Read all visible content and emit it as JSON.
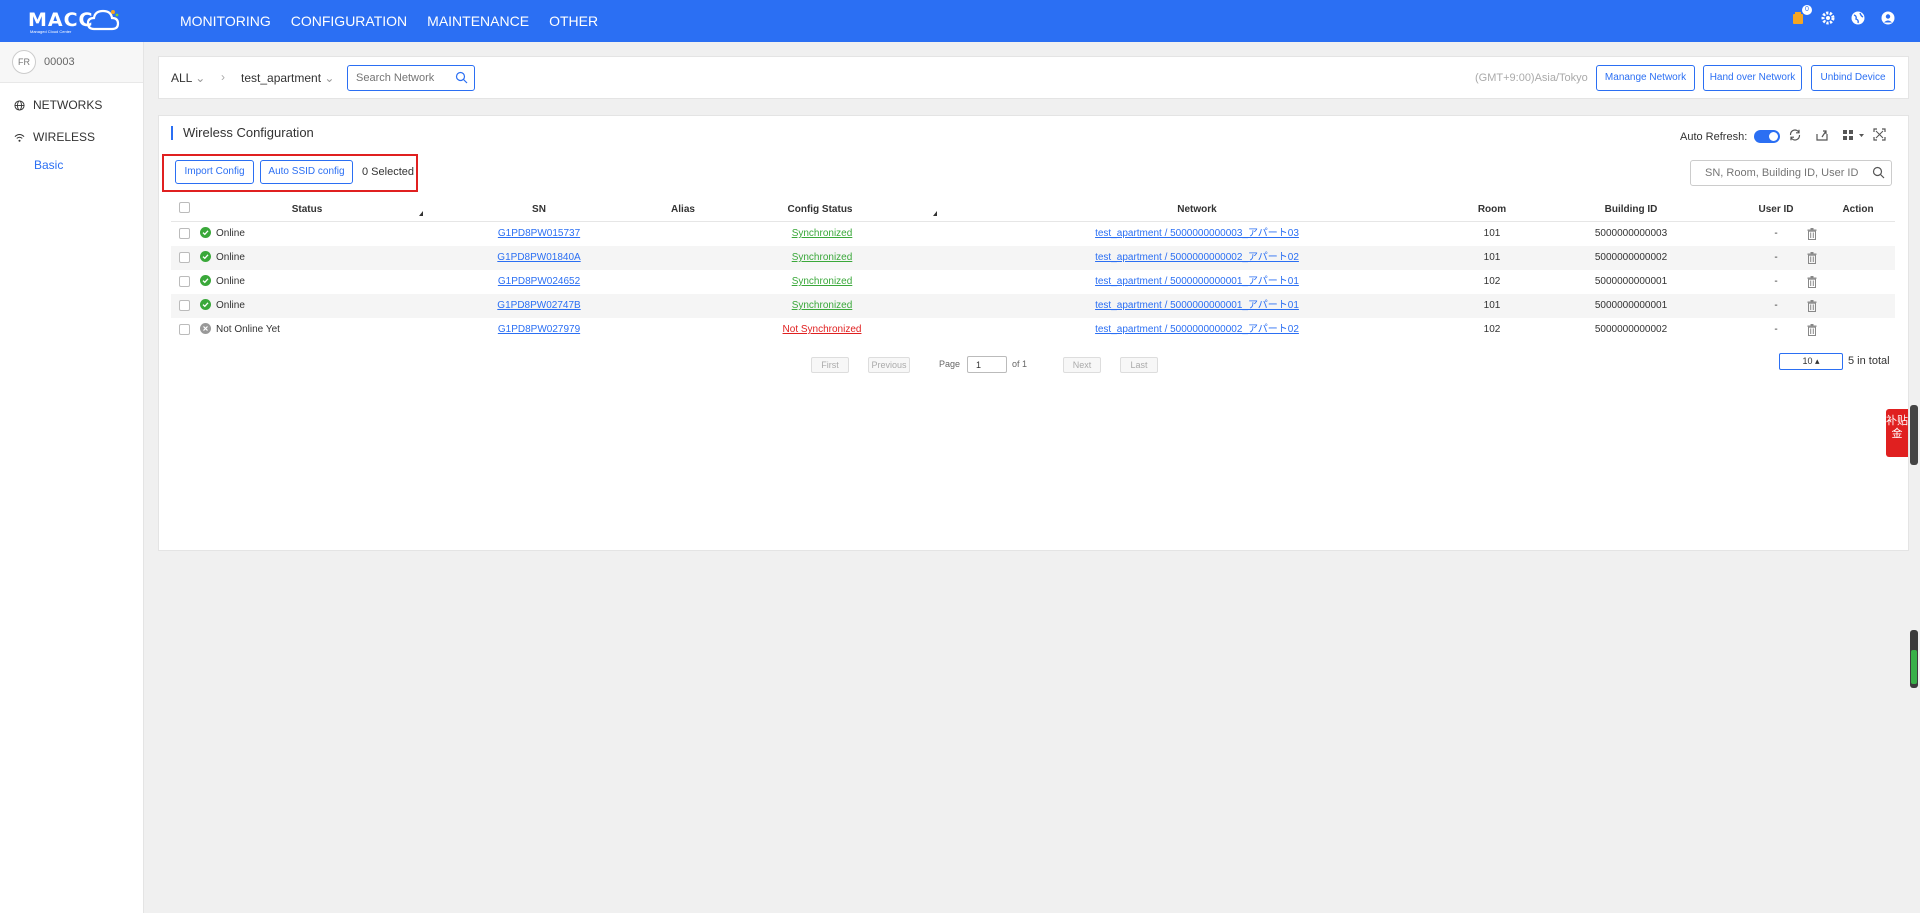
{
  "app": {
    "logo_text": "MACC",
    "logo_sub": "Managed  Cloud Center"
  },
  "topnav": {
    "items": [
      "MONITORING",
      "CONFIGURATION",
      "MAINTENANCE",
      "OTHER"
    ]
  },
  "notifications": {
    "count": "0"
  },
  "account": {
    "avatar": "FR",
    "name": "00003"
  },
  "sidebar": {
    "items": [
      {
        "label": "NETWORKS",
        "icon": "globe-icon"
      },
      {
        "label": "WIRELESS",
        "icon": "wifi-icon"
      }
    ],
    "sub_items": [
      "Basic"
    ]
  },
  "filterbar": {
    "scope": "ALL",
    "network": "test_apartment",
    "search_placeholder": "Search Network",
    "timezone": "(GMT+9:00)Asia/Tokyo",
    "buttons": [
      "Manange Network",
      "Hand over Network",
      "Unbind Device"
    ]
  },
  "card": {
    "title": "Wireless Configuration",
    "auto_refresh_label": "Auto Refresh:",
    "auto_refresh_on": true,
    "import_label": "Import Config",
    "auto_ssid_label": "Auto SSID config",
    "selected_text": "0 Selected",
    "search_placeholder": "SN, Room, Building ID, User ID"
  },
  "table": {
    "headers": {
      "status": "Status",
      "sn": "SN",
      "alias": "Alias",
      "config_status": "Config Status",
      "network": "Network",
      "room": "Room",
      "building": "Building ID",
      "user": "User ID",
      "action": "Action"
    },
    "rows": [
      {
        "status": "Online",
        "online": true,
        "sn": "G1PD8PW015737",
        "alias": "",
        "config": "Synchronized",
        "synced": true,
        "network": "test_apartment / 5000000000003_アパート03",
        "room": "101",
        "building": "5000000000003",
        "user": "-"
      },
      {
        "status": "Online",
        "online": true,
        "sn": "G1PD8PW01840A",
        "alias": "",
        "config": "Synchronized",
        "synced": true,
        "network": "test_apartment / 5000000000002_アパート02",
        "room": "101",
        "building": "5000000000002",
        "user": "-"
      },
      {
        "status": "Online",
        "online": true,
        "sn": "G1PD8PW024652",
        "alias": "",
        "config": "Synchronized",
        "synced": true,
        "network": "test_apartment / 5000000000001_アパート01",
        "room": "102",
        "building": "5000000000001",
        "user": "-"
      },
      {
        "status": "Online",
        "online": true,
        "sn": "G1PD8PW02747B",
        "alias": "",
        "config": "Synchronized",
        "synced": true,
        "network": "test_apartment / 5000000000001_アパート01",
        "room": "101",
        "building": "5000000000001",
        "user": "-"
      },
      {
        "status": "Not Online Yet",
        "online": false,
        "sn": "G1PD8PW027979",
        "alias": "",
        "config": "Not Synchronized",
        "synced": false,
        "network": "test_apartment / 5000000000002_アパート02",
        "room": "102",
        "building": "5000000000002",
        "user": "-"
      }
    ]
  },
  "pagination": {
    "first": "First",
    "previous": "Previous",
    "page_label": "Page",
    "page": "1",
    "of_label": "of 1",
    "next": "Next",
    "last": "Last",
    "page_size": "10 ▴",
    "total": "5 in total"
  },
  "float_tab": {
    "text": "补贴金"
  },
  "colors": {
    "primary": "#2b6ff3",
    "online": "#3aa83a",
    "error": "#e02020"
  }
}
